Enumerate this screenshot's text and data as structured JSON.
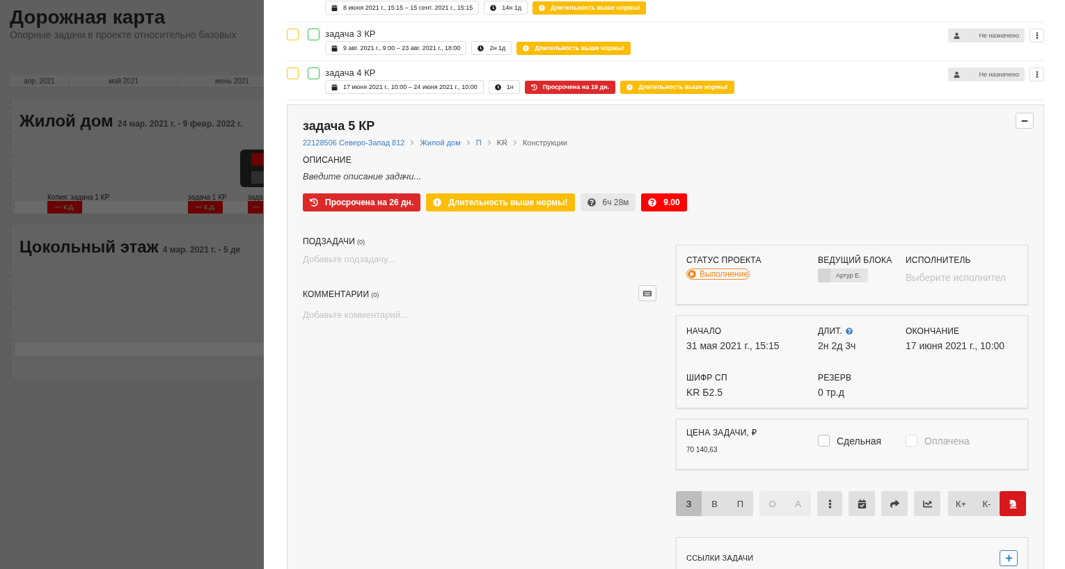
{
  "background_page": {
    "title": "Дорожная карта",
    "subtitle": "Опорные задачи в проекте относительно базовых",
    "months": [
      {
        "label": "апр. 2021"
      },
      {
        "label": "май 2021"
      },
      {
        "label": "июнь 2021"
      }
    ],
    "sections": [
      {
        "name": "Жилой дом",
        "dates": "24 мар. 2021 г. - 9 февр. 2022 г.",
        "popup": true,
        "tasks": [
          {
            "label": "Копия: задача 1 КР",
            "chip": "— к.д."
          },
          {
            "label": "задача 1 КР",
            "chip": "— к.д."
          },
          {
            "label": "зада",
            "chip": "—"
          }
        ]
      },
      {
        "name": "Цокольный этаж",
        "dates": "4 мар. 2021 г. - 5 де",
        "popup": false
      }
    ]
  },
  "task_list": [
    {
      "date_range": "8 июня 2021 г., 15:15 – 15 сент. 2021 г., 15:15",
      "duration": "14н 1д",
      "badges": [
        {
          "kind": "warning",
          "text": "Длительность выше нормы!"
        }
      ]
    },
    {
      "title": "задача 3 КР",
      "checkboxes": [
        {
          "color": "#f5c518",
          "checked": false
        },
        {
          "color": "#2fbf4a",
          "checked": false
        }
      ],
      "date_range": "9 авг. 2021 г., 9:00 – 23 авг. 2021 г., 18:00",
      "duration": "2н 1д",
      "badges": [
        {
          "kind": "warning",
          "text": "Длительность выше нормы!"
        }
      ],
      "assignee": "Не назначено"
    },
    {
      "title": "задача 4 КР",
      "checkboxes": [
        {
          "color": "#f5c518",
          "checked": false
        },
        {
          "color": "#2fbf4a",
          "checked": false
        }
      ],
      "date_range": "17 июня 2021 г., 10:00 – 24 июня 2021 г., 10:00",
      "duration": "1н",
      "badges": [
        {
          "kind": "overdue",
          "text": "Просрочена на 19 дн."
        },
        {
          "kind": "warning",
          "text": "Длительность выше нормы!"
        }
      ],
      "assignee": "Не назначено"
    }
  ],
  "task_detail": {
    "title": "задача 5 КР",
    "breadcrumb": [
      {
        "text": "22128506 Северо-Запад 812",
        "link": true
      },
      {
        "text": "Жилой дом",
        "link": true
      },
      {
        "text": "П",
        "link": true
      },
      {
        "text": "KR",
        "link": false
      },
      {
        "text": "Конструкции",
        "link": false
      }
    ],
    "description_label": "ОПИСАНИЕ",
    "description_placeholder": "Введите описание задачи...",
    "badges": [
      {
        "kind": "overdue",
        "text": "Просрочена на 26 дн."
      },
      {
        "kind": "warning",
        "text": "Длительность выше нормы!"
      },
      {
        "kind": "time",
        "text": "6ч 28м"
      },
      {
        "kind": "score",
        "text": "9.00"
      }
    ],
    "subtasks": {
      "label": "ПОДЗАДАЧИ",
      "count": "(0)",
      "placeholder": "Добавьте подзадачу..."
    },
    "comments": {
      "label": "КОММЕНТАРИИ",
      "count": "(0)",
      "placeholder": "Добавьте комментарий..."
    },
    "status": {
      "label": "СТАТУС ПРОЕКТА",
      "value": "Выполнение"
    },
    "lead": {
      "label": "ВЕДУЩИЙ БЛОКА",
      "value": "Артур Е."
    },
    "executor": {
      "label": "ИСПОЛНИТЕЛЬ",
      "placeholder": "Выберите исполнител"
    },
    "schedule": [
      {
        "label": "НАЧАЛО",
        "value": "31 мая 2021 г., 15:15",
        "help": false
      },
      {
        "label": "ДЛИТ.",
        "value": "2н 2д 3ч",
        "help": true
      },
      {
        "label": "ОКОНЧАНИЕ",
        "value": "17 июня 2021 г., 10:00",
        "help": false
      },
      {
        "label": "ШИФР СП",
        "value": "KR Б2.5",
        "help": false
      },
      {
        "label": "РЕЗЕРВ",
        "value": "0 тр.д",
        "help": false
      }
    ],
    "price": {
      "label": "ЦЕНА ЗАДАЧИ, ₽",
      "value": "70 140,63",
      "options": [
        {
          "label": "Сдельная",
          "checked": false,
          "disabled": false
        },
        {
          "label": "Оплачена",
          "checked": false,
          "disabled": true
        }
      ]
    },
    "priority": [
      {
        "label": "З",
        "selected": true
      },
      {
        "label": "В",
        "selected": false
      },
      {
        "label": "П",
        "selected": false
      }
    ],
    "modes": {
      "disabled": true,
      "items": [
        {
          "label": "О"
        },
        {
          "label": "А"
        }
      ]
    },
    "criticality": [
      {
        "label": "К+"
      },
      {
        "label": "К-"
      }
    ],
    "links_label": "ССЫЛКИ ЗАДАЧИ"
  }
}
